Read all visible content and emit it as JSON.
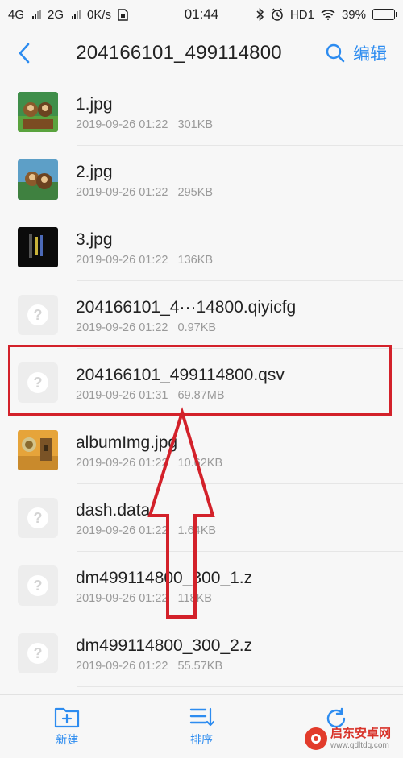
{
  "status_bar": {
    "net1": "4G",
    "net2": "2G",
    "speed": "0K/s",
    "time": "01:44",
    "hd": "HD1",
    "battery": "39%",
    "battery_level": 0.39
  },
  "header": {
    "title": "204166101_499114800",
    "edit_label": "编辑"
  },
  "files": [
    {
      "name": "1.jpg",
      "date": "2019-09-26 01:22",
      "size": "301KB",
      "thumb": "image-cartoon-bears"
    },
    {
      "name": "2.jpg",
      "date": "2019-09-26 01:22",
      "size": "295KB",
      "thumb": "image-cartoon-bears"
    },
    {
      "name": "3.jpg",
      "date": "2019-09-26 01:22",
      "size": "136KB",
      "thumb": "image-dark"
    },
    {
      "name": "204166101_4···14800.qiyicfg",
      "date": "2019-09-26 01:22",
      "size": "0.97KB",
      "thumb": "generic-file-icon"
    },
    {
      "name": "204166101_499114800.qsv",
      "date": "2019-09-26 01:31",
      "size": "69.87MB",
      "thumb": "generic-file-icon"
    },
    {
      "name": "albumImg.jpg",
      "date": "2019-09-26 01:22",
      "size": "10.62KB",
      "thumb": "image-album"
    },
    {
      "name": "dash.data",
      "date": "2019-09-26 01:22",
      "size": "1.64KB",
      "thumb": "generic-file-icon"
    },
    {
      "name": "dm499114800_300_1.z",
      "date": "2019-09-26 01:22",
      "size": "118KB",
      "thumb": "generic-file-icon"
    },
    {
      "name": "dm499114800_300_2.z",
      "date": "2019-09-26 01:22",
      "size": "55.57KB",
      "thumb": "generic-file-icon"
    }
  ],
  "toolbar": {
    "new_label": "新建",
    "sort_label": "排序"
  },
  "watermark": {
    "title": "启东安卓网",
    "url": "www.qdltdq.com"
  },
  "colors": {
    "accent": "#2d8cf0",
    "highlight": "#d3212a"
  }
}
